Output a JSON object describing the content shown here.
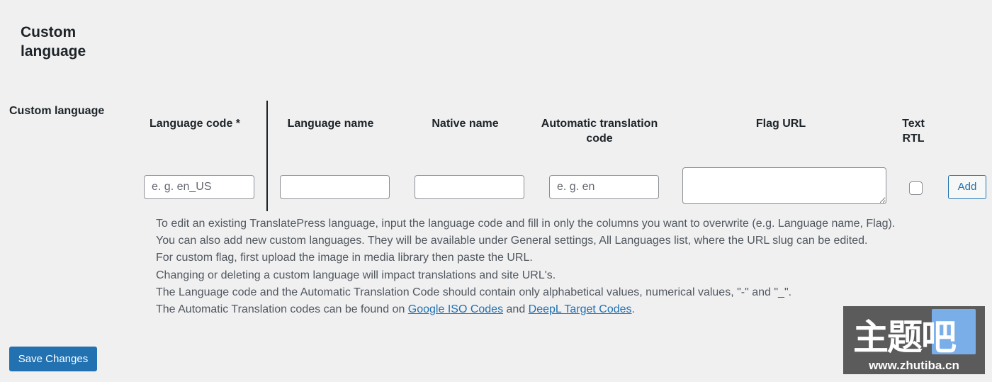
{
  "page": {
    "title": "Custom language"
  },
  "section": {
    "row_label": "Custom language",
    "columns": [
      {
        "label": "Language code *"
      },
      {
        "label": "Language name"
      },
      {
        "label": "Native name"
      },
      {
        "label": "Automatic translation code"
      },
      {
        "label": "Flag URL"
      },
      {
        "label": "Text RTL"
      }
    ],
    "inputs": {
      "language_code_placeholder": "e. g. en_US",
      "language_name_placeholder": "",
      "native_name_placeholder": "",
      "auto_code_placeholder": "e. g. en"
    },
    "add_label": "Add"
  },
  "description": {
    "lines": [
      "To edit an existing TranslatePress language, input the language code and fill in only the columns you want to overwrite (e.g. Language name, Flag).",
      "You can also add new custom languages. They will be available under General settings, All Languages list, where the URL slug can be edited.",
      "For custom flag, first upload the image in media library then paste the URL.",
      "Changing or deleting a custom language will impact translations and site URL's.",
      "The Language code and the Automatic Translation Code should contain only alphabetical values, numerical values, \"-\" and \"_\"."
    ],
    "last_line": {
      "prefix": "The Automatic Translation codes can be found on ",
      "link1": "Google ISO Codes",
      "middle": " and ",
      "link2": "DeepL Target Codes",
      "suffix": "."
    }
  },
  "footer": {
    "save_label": "Save Changes"
  },
  "watermark": {
    "logo_text": "主题吧",
    "url": "www.zhutiba.cn"
  },
  "colors": {
    "accent": "#2271b1",
    "background": "#f0f0f1"
  }
}
